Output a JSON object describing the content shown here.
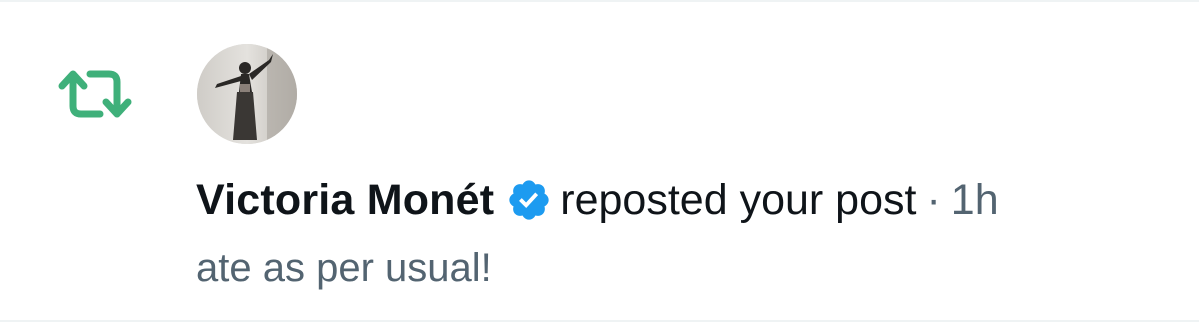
{
  "notification": {
    "type_icon": "repost-icon",
    "user": {
      "name": "Victoria Monét",
      "verified": true,
      "verified_icon": "verified-badge-icon",
      "avatar_icon": "avatar-image"
    },
    "action": "reposted your post",
    "separator": "·",
    "timestamp": "1h",
    "post_excerpt": "ate as per usual!"
  },
  "colors": {
    "repost_green": "#3fb07a",
    "verified_blue": "#1d9bf0",
    "primary_text": "#0f1419",
    "secondary_text": "#536471",
    "divider": "#eff3f4"
  }
}
